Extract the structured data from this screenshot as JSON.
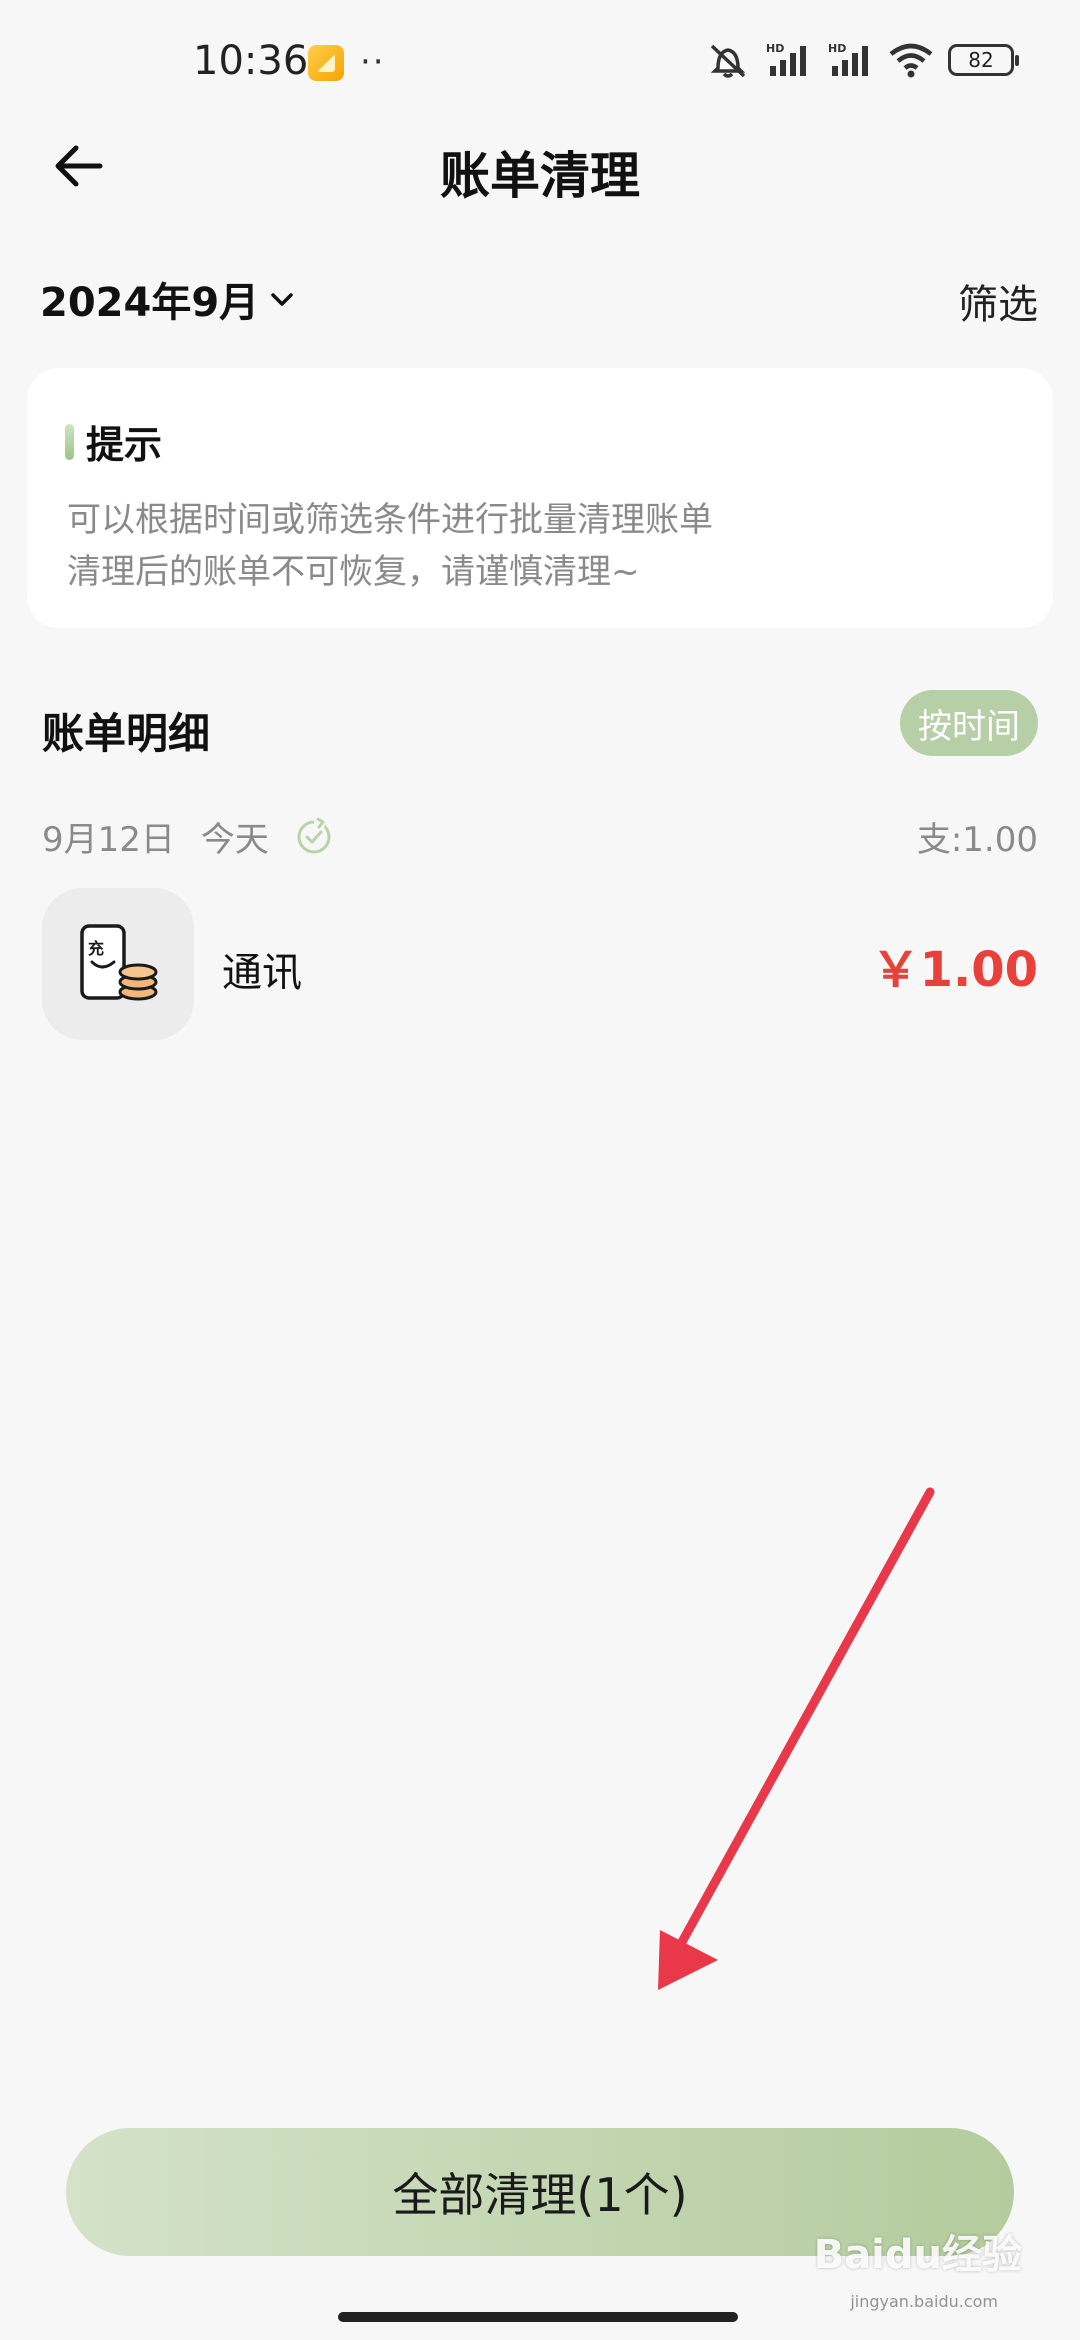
{
  "status_bar": {
    "time": "10:36",
    "dots": "··",
    "battery": "82",
    "signal_labels": [
      "HD",
      "HD"
    ]
  },
  "header": {
    "title": "账单清理"
  },
  "month_selector": {
    "label": "2024年9月"
  },
  "filter": {
    "label": "筛选"
  },
  "tip": {
    "title": "提示",
    "line1": "可以根据时间或筛选条件进行批量清理账单",
    "line2": "清理后的账单不可恢复，请谨慎清理~"
  },
  "bills_section": {
    "title": "账单明细",
    "sort_label": "按时间"
  },
  "group": {
    "date": "9月12日",
    "day_label": "今天",
    "summary": "支:1.00"
  },
  "bill_item": {
    "name": "通讯",
    "amount": "￥1.00",
    "icon_char": "充",
    "icon": "phone-recharge-icon"
  },
  "clear_all_button": {
    "label": "全部清理(1个)"
  },
  "watermark": {
    "brand": "Baidu经验",
    "url": "jingyan.baidu.com"
  },
  "colors": {
    "accent_green": "#b3cb9d",
    "amount_red": "#e8413b",
    "annotation_red": "#e8384a"
  }
}
